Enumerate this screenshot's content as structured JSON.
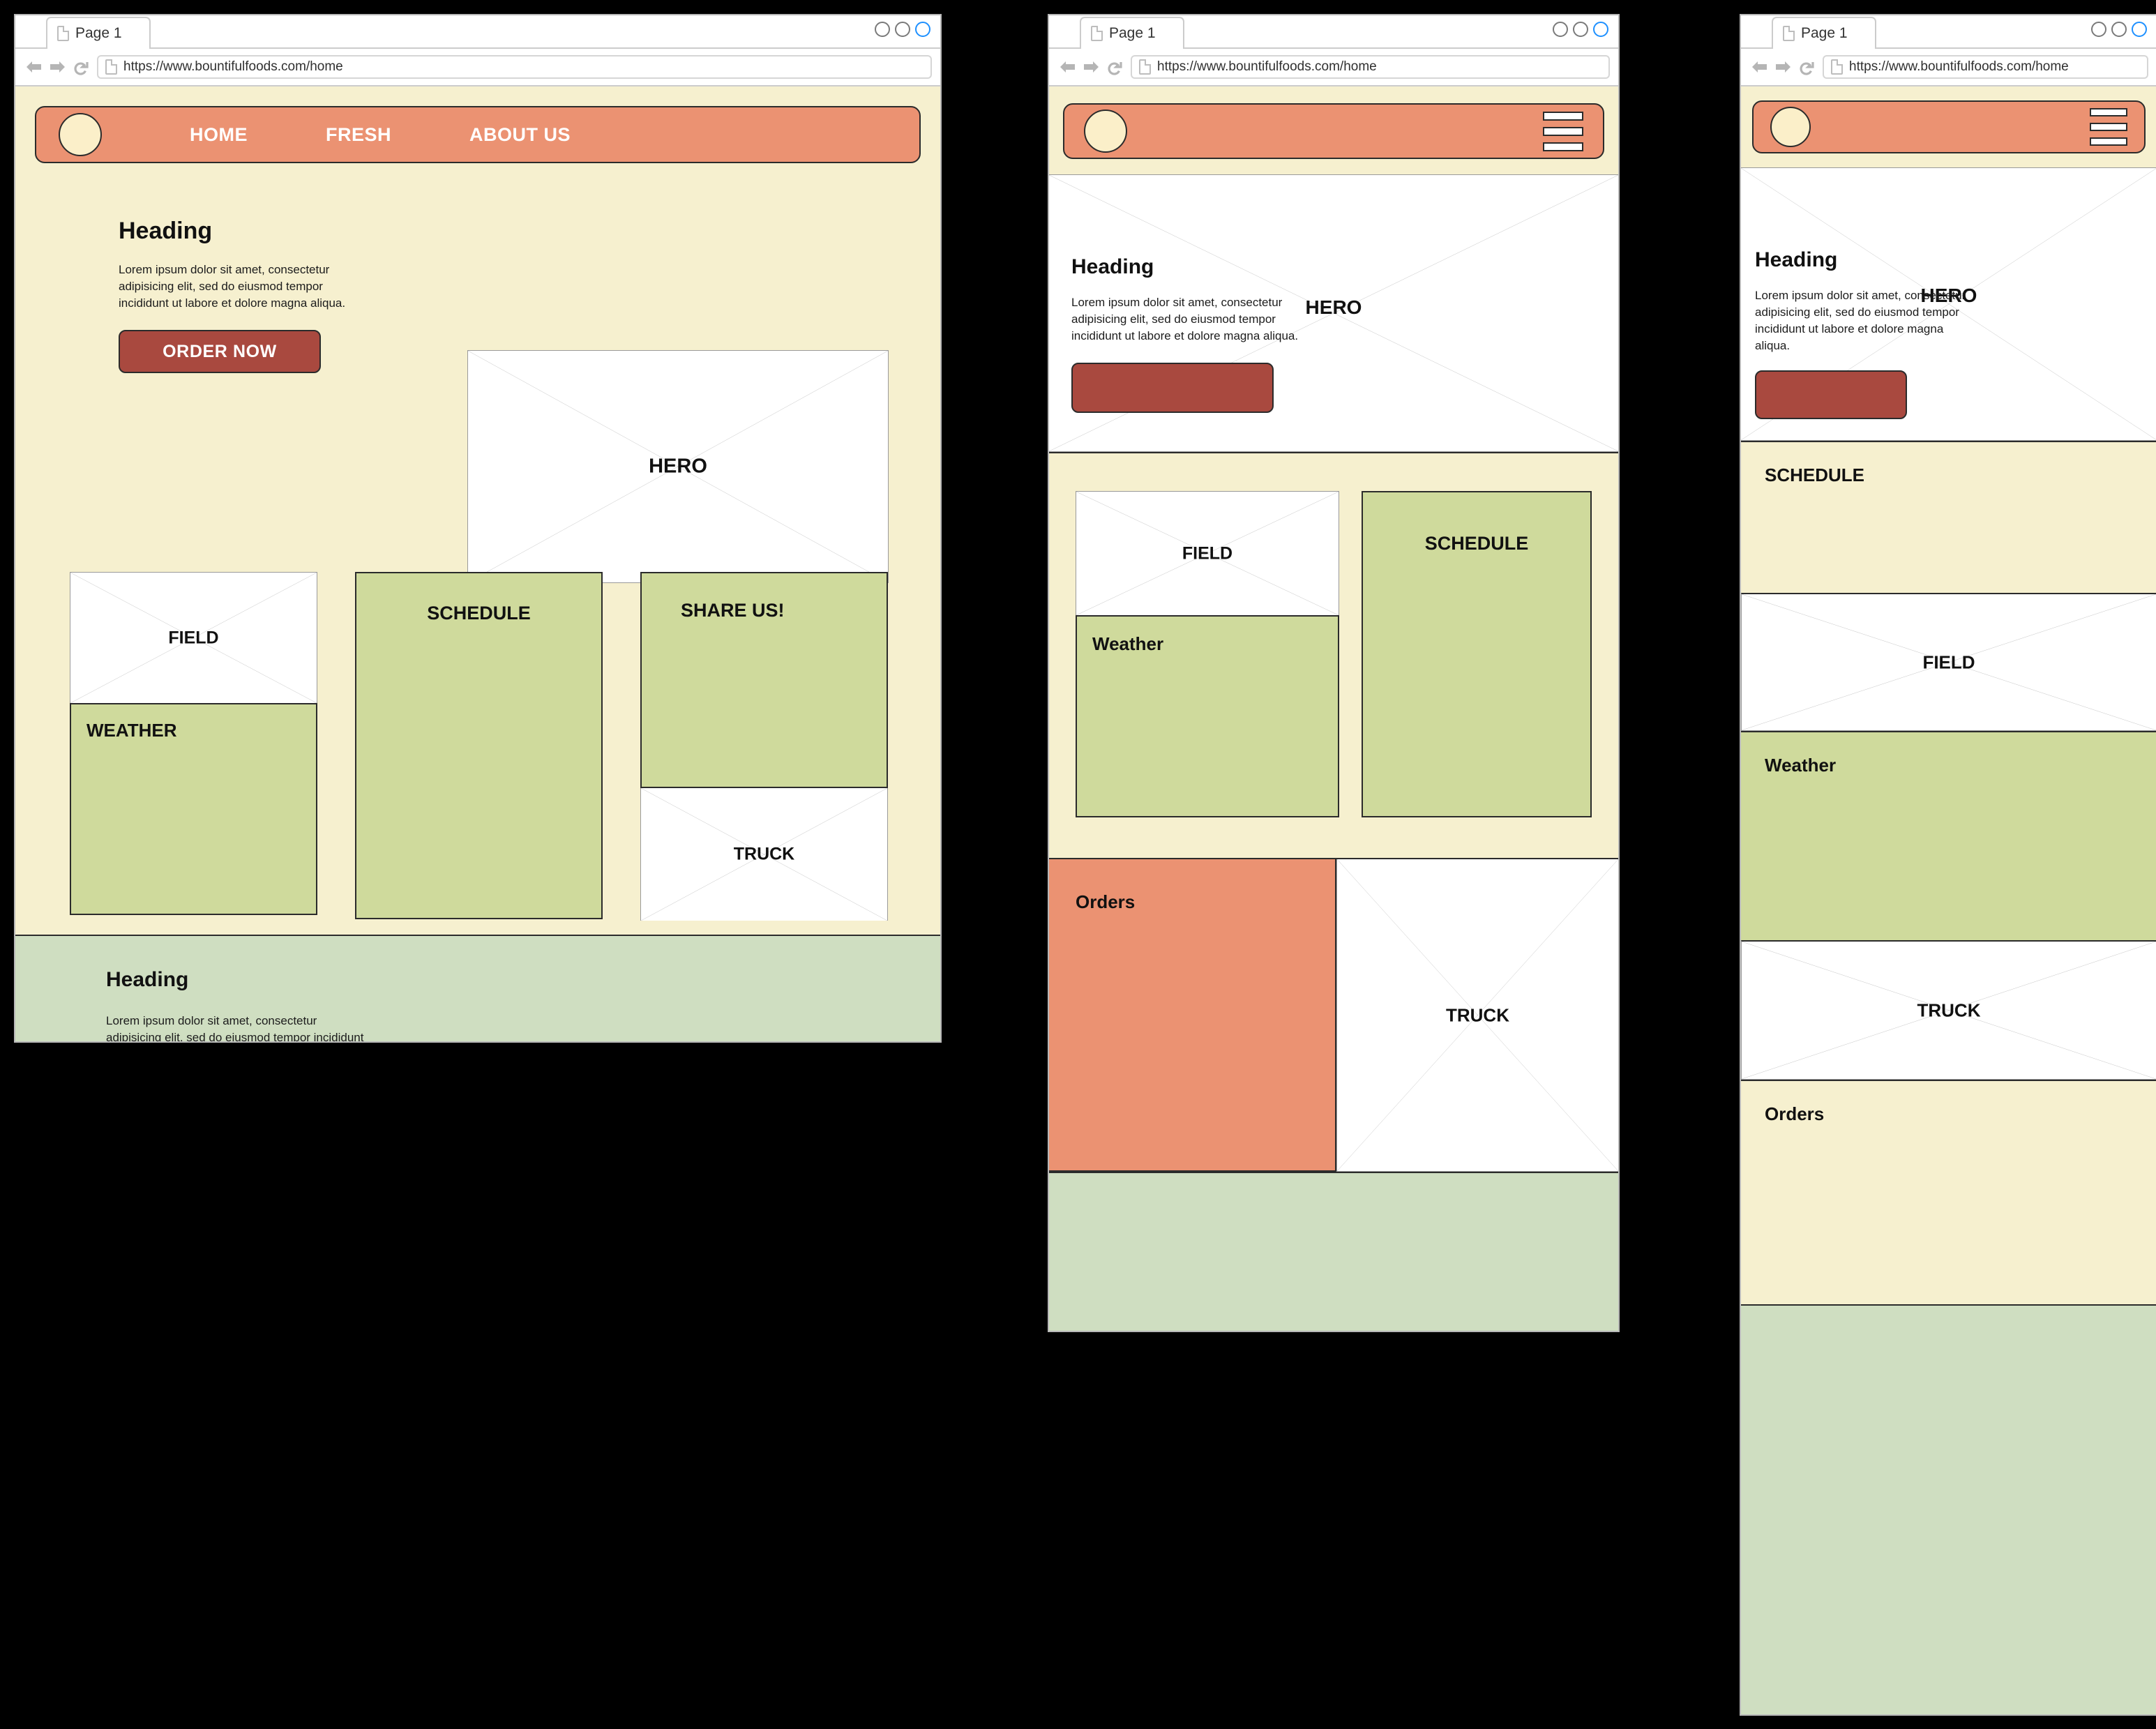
{
  "browser": {
    "tab_label": "Page 1",
    "url": "https://www.bountifulfoods.com/home",
    "back_icon": "back-arrow-icon",
    "forward_icon": "forward-arrow-icon",
    "reload_icon": "reload-icon",
    "page_icon": "page-icon",
    "window_controls": [
      "circle",
      "circle",
      "circle-accent"
    ],
    "accent_color": "#1e90ff"
  },
  "colors": {
    "page_cream": "#f6f0cf",
    "green_panel": "#cfda9c",
    "sage_footer": "#cfdec1",
    "salmon": "#eb9272",
    "cta_dark_red": "#a9493f",
    "logo_cream": "#fbefc9",
    "outline": "#2b2b2b"
  },
  "site": {
    "nav_links": [
      "HOME",
      "FRESH",
      "ABOUT US"
    ],
    "logo": "circle-logo",
    "menu_icon": "hamburger-menu-icon"
  },
  "hero": {
    "heading": "Heading",
    "body": "Lorem ipsum dolor sit amet, consectetur adipisicing elit, sed do eiusmod tempor incididunt ut labore et dolore magna aliqua.",
    "cta_label": "ORDER NOW",
    "image_label": "HERO"
  },
  "desktop": {
    "field_label": "FIELD",
    "weather_label": "WEATHER",
    "schedule_label": "SCHEDULE",
    "share_label": "SHARE US!",
    "truck_label": "TRUCK"
  },
  "tablet": {
    "field_label": "FIELD",
    "weather_label": "Weather",
    "schedule_label": "SCHEDULE",
    "orders_label": "Orders",
    "truck_label": "TRUCK"
  },
  "mobile": {
    "schedule_label": "SCHEDULE",
    "field_label": "FIELD",
    "weather_label": "Weather",
    "truck_label": "TRUCK",
    "orders_label": "Orders"
  },
  "footer": {
    "heading": "Heading",
    "body": "Lorem ipsum dolor sit amet, consectetur adipisicing elit, sed do eiusmod tempor incididunt ut labore et dolore magna aliqua."
  }
}
